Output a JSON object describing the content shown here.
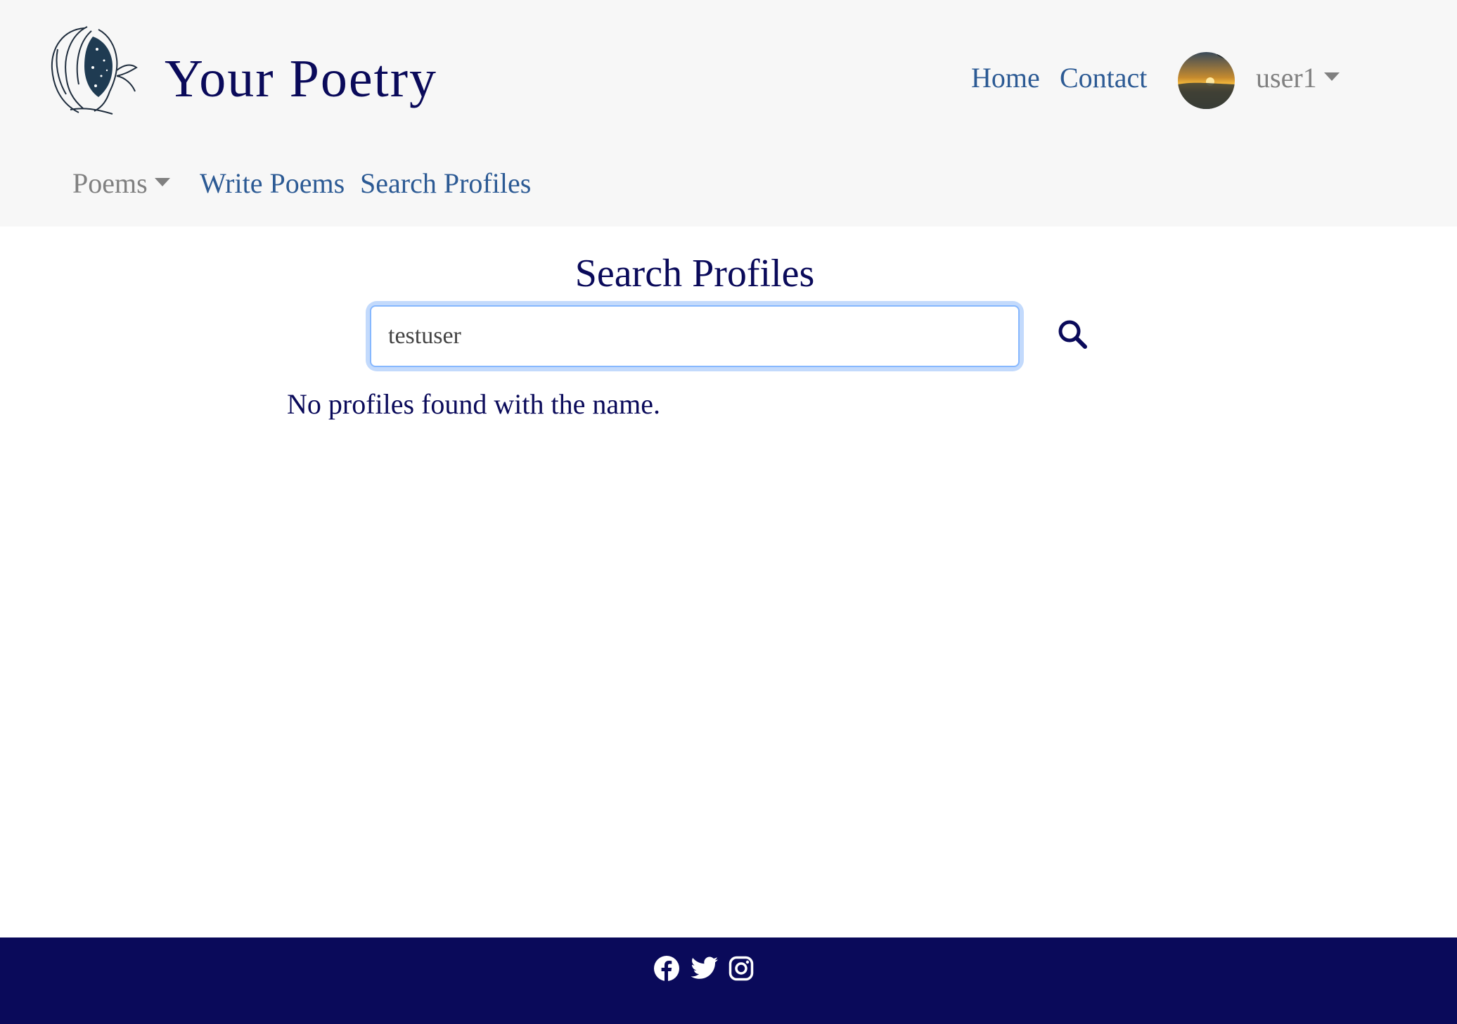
{
  "header": {
    "brand": "Your Poetry",
    "nav": {
      "home": "Home",
      "contact": "Contact"
    },
    "user": {
      "name": "user1"
    },
    "subnav": {
      "poems": "Poems",
      "write": "Write Poems",
      "search": "Search Profiles"
    }
  },
  "main": {
    "title": "Search Profiles",
    "search": {
      "value": "testuser"
    },
    "result_message": "No profiles found with the name."
  },
  "footer": {
    "social": [
      "facebook-icon",
      "twitter-icon",
      "instagram-icon"
    ]
  },
  "colors": {
    "brand_navy": "#0a0a5a",
    "link_blue": "#2c5a94",
    "muted_gray": "#808080",
    "header_bg": "#f7f7f7",
    "focus_ring": "#86b7fe"
  }
}
